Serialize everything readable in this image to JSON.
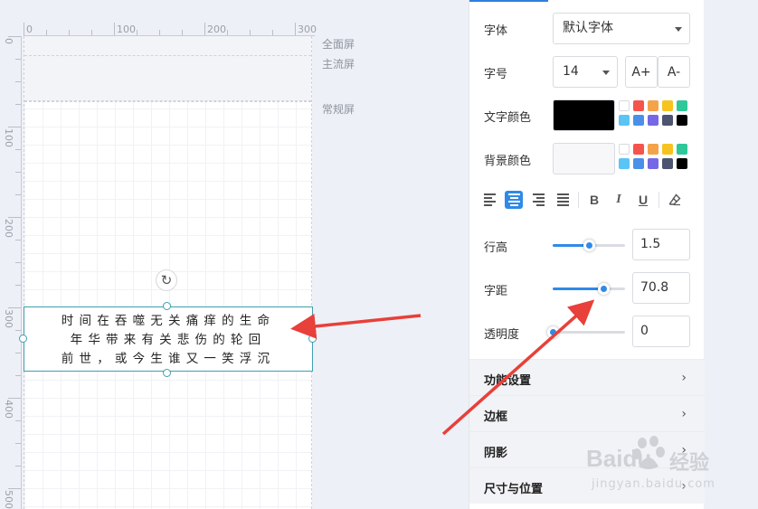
{
  "ruler": {
    "top_labels": [
      "0",
      "100",
      "200",
      "300"
    ],
    "left_labels": [
      "0",
      "100",
      "200",
      "300",
      "400",
      "500"
    ]
  },
  "screens": {
    "full": "全面屏",
    "mainstream": "主流屏",
    "regular": "常规屏"
  },
  "text_element": {
    "lines": [
      "时间在吞噬无关痛痒的生命",
      "年华带来有关悲伤的轮回",
      "前世，或今生谁又一笑浮沉"
    ]
  },
  "panel": {
    "font": {
      "label": "字体",
      "value": "默认字体"
    },
    "size": {
      "label": "字号",
      "value": "14",
      "increase": "A+",
      "decrease": "A-"
    },
    "text_color": {
      "label": "文字颜色",
      "current": "#000000"
    },
    "bg_color": {
      "label": "背景颜色",
      "current": "#f7f7f9"
    },
    "palette": [
      "#ffffff",
      "#f5544d",
      "#f3a34a",
      "#f7c31f",
      "#2ec89a",
      "#5ac4f5",
      "#4a90e8",
      "#7468e6",
      "#4c5470",
      "#000000"
    ],
    "line_height": {
      "label": "行高",
      "value": "1.5",
      "level": 0.5
    },
    "letter_spacing": {
      "label": "字距",
      "value": "70.8",
      "level": 0.7
    },
    "opacity": {
      "label": "透明度",
      "value": "0",
      "level": 0.0
    },
    "sections": [
      {
        "title": "功能设置"
      },
      {
        "title": "边框"
      },
      {
        "title": "阴影"
      },
      {
        "title": "尺寸与位置"
      }
    ]
  },
  "accent": "#2f8ae8",
  "arrow_color": "#e8403a",
  "watermark": {
    "brand": "Baidu",
    "suffix": "经验",
    "url": "jingyan.baidu.com"
  }
}
